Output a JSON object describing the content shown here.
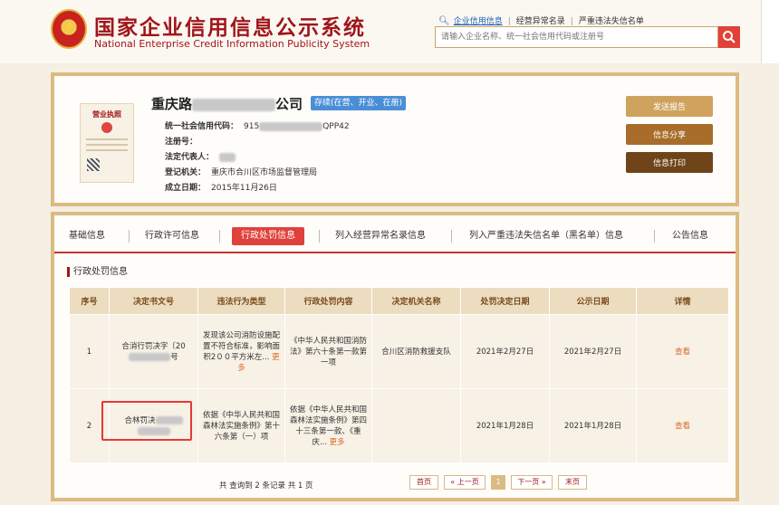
{
  "header": {
    "title_cn": "国家企业信用信息公示系统",
    "title_en": "National Enterprise Credit Information Publicity System",
    "links": [
      "企业信用信息",
      "经营异常名录",
      "严重违法失信名单"
    ],
    "search_placeholder": "请输入企业名称、统一社会信用代码或注册号"
  },
  "license": {
    "label": "营业执照"
  },
  "company": {
    "name_prefix": "重庆路",
    "name_suffix": "公司",
    "status": "存续(在营、开业、在册)",
    "credit_code_label": "统一社会信用代码：",
    "credit_code_start": "915",
    "credit_code_end": "QPP42",
    "reg_no_label": "注册号：",
    "legal_rep_label": "法定代表人：",
    "authority_label": "登记机关：",
    "authority_value": "重庆市合川区市场监督管理局",
    "date_label": "成立日期：",
    "date_value": "2015年11月26日"
  },
  "actions": {
    "send_report": "发送报告",
    "share": "信息分享",
    "print": "信息打印"
  },
  "tabs": [
    "基础信息",
    "行政许可信息",
    "行政处罚信息",
    "列入经营异常名录信息",
    "列入严重违法失信名单（黑名单）信息",
    "公告信息"
  ],
  "section_title": "行政处罚信息",
  "table": {
    "headers": [
      "序号",
      "决定书文号",
      "违法行为类型",
      "行政处罚内容",
      "决定机关名称",
      "处罚决定日期",
      "公示日期",
      "详情"
    ],
    "rows": [
      {
        "no": "1",
        "doc_no": "合消行罚决字〔20",
        "doc_no_tail": "号",
        "violation": "发现该公司消防设施配置不符合标准，影响面积2００平方米左...",
        "violation_more": "更多",
        "content": "《中华人民共和国消防法》第六十条第一款第一项",
        "authority": "合川区消防救援支队",
        "decision_date": "2021年2月27日",
        "publish_date": "2021年2月27日",
        "detail": "查看"
      },
      {
        "no": "2",
        "doc_no": "合林罚决",
        "doc_no_tail": "",
        "violation": "依据《中华人民共和国森林法实施条例》第十六条第（一）项",
        "violation_more": "",
        "content": "依据《中华人民共和国森林法实施条例》第四十三条第一款、《重庆...",
        "content_more": "更多",
        "authority": "",
        "decision_date": "2021年1月28日",
        "publish_date": "2021年1月28日",
        "detail": "查看"
      }
    ]
  },
  "pagination": {
    "summary": "共 查询到 2 条记录 共 1 页",
    "first": "首页",
    "prev": "« 上一页",
    "current": "1",
    "next": "下一页 »",
    "last": "末页"
  }
}
